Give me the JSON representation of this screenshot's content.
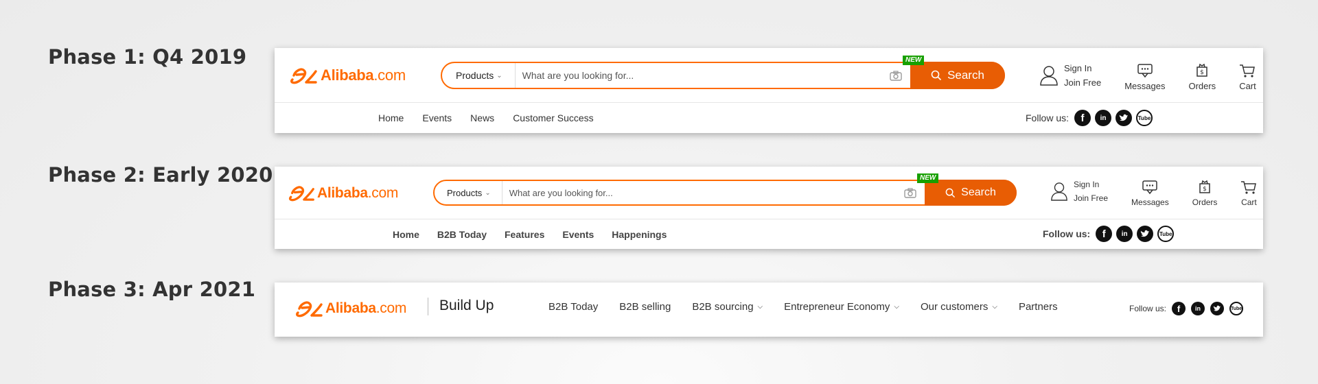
{
  "phases": [
    {
      "label": "Phase 1: Q4 2019",
      "logo": {
        "brand": "Alibaba",
        "suffix": ".com"
      },
      "search": {
        "category": "Products",
        "placeholder": "What are you looking for...",
        "badge": "NEW",
        "button": "Search"
      },
      "utility": {
        "sign_in": "Sign In",
        "join": "Join Free",
        "messages": "Messages",
        "orders": "Orders",
        "cart": "Cart"
      },
      "nav": [
        "Home",
        "Events",
        "News",
        "Customer Success"
      ],
      "follow": "Follow us:"
    },
    {
      "label": "Phase 2: Early 2020",
      "logo": {
        "brand": "Alibaba",
        "suffix": ".com"
      },
      "search": {
        "category": "Products",
        "placeholder": "What are you looking for...",
        "badge": "NEW",
        "button": "Search"
      },
      "utility": {
        "sign_in": "Sign In",
        "join": "Join Free",
        "messages": "Messages",
        "orders": "Orders",
        "cart": "Cart"
      },
      "nav": [
        "Home",
        "B2B Today",
        "Features",
        "Events",
        "Happenings"
      ],
      "follow": "Follow us:"
    },
    {
      "label": "Phase 3: Apr 2021",
      "logo": {
        "brand": "Alibaba",
        "suffix": ".com"
      },
      "tagline": "Build Up",
      "nav": [
        {
          "label": "B2B Today",
          "dropdown": false
        },
        {
          "label": "B2B selling",
          "dropdown": false
        },
        {
          "label": "B2B sourcing",
          "dropdown": true
        },
        {
          "label": "Entrepreneur Economy",
          "dropdown": true
        },
        {
          "label": "Our customers",
          "dropdown": true
        },
        {
          "label": "Partners",
          "dropdown": false
        }
      ],
      "follow": "Follow us:"
    }
  ],
  "social_icons": [
    "facebook-icon",
    "linkedin-icon",
    "twitter-icon",
    "youtube-icon"
  ],
  "social_glyphs": {
    "facebook": "f",
    "linkedin": "in",
    "youtube": "Tube"
  },
  "colors": {
    "brand_orange": "#ff6a00",
    "search_button": "#e85d04",
    "new_badge": "#18a000"
  }
}
